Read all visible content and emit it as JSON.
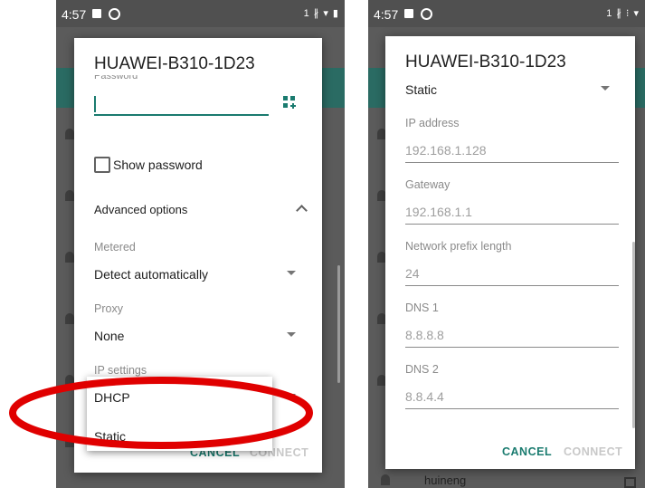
{
  "left": {
    "status": {
      "time": "4:57",
      "right": "1 ∦ ▾ ▮"
    },
    "dialog": {
      "title": "HUAWEI-B310-1D23",
      "password_label": "Password",
      "show_password_label": "Show password",
      "advanced_options_label": "Advanced options",
      "metered_label": "Metered",
      "metered_value": "Detect automatically",
      "proxy_label": "Proxy",
      "proxy_value": "None",
      "ip_settings_label": "IP settings",
      "cancel": "CANCEL",
      "connect": "CONNECT"
    },
    "dropdown_options": [
      "DHCP",
      "Static"
    ]
  },
  "right": {
    "status": {
      "time": "4:57",
      "right": "1 ∦ ⁝ ▾"
    },
    "dialog": {
      "title": "HUAWEI-B310-1D23",
      "ip_settings_value": "Static",
      "ip_address_label": "IP address",
      "ip_address_value": "192.168.1.128",
      "gateway_label": "Gateway",
      "gateway_value": "192.168.1.1",
      "prefix_label": "Network prefix length",
      "prefix_value": "24",
      "dns1_label": "DNS 1",
      "dns1_value": "8.8.8.8",
      "dns2_label": "DNS 2",
      "dns2_value": "8.8.4.4",
      "cancel": "CANCEL",
      "connect": "CONNECT"
    },
    "background_item": "huineng"
  },
  "colors": {
    "accent": "#1a7b6f",
    "annotation": "#e00000",
    "teal_bar": "#2a6b63"
  },
  "icons": [
    "image-icon",
    "circle-icon",
    "qr-code-icon",
    "chevron-up-icon",
    "dropdown-arrow-icon",
    "checkbox-icon",
    "wifi-icon",
    "lock-icon"
  ]
}
